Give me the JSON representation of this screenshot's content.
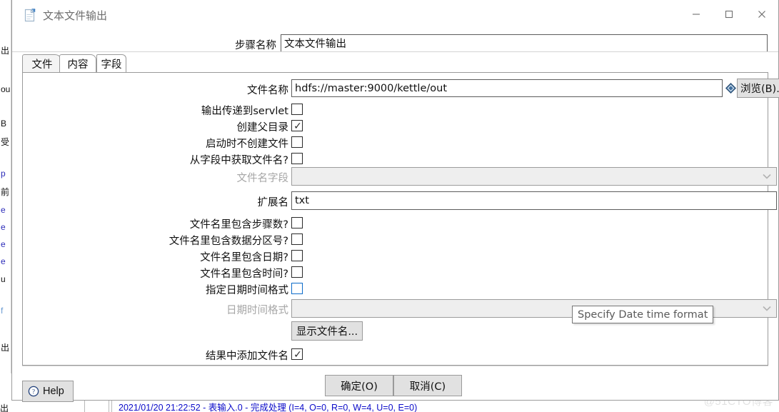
{
  "background": {
    "left_strip_lines": [
      "出",
      "ou",
      "B",
      "受",
      "p",
      "前",
      "e",
      "e",
      "e",
      "e",
      "u",
      "f",
      "出"
    ],
    "bottom_log": "2021/01/20 21:22:52 - 表输入.0 - 完成处理 (I=4, O=0, R=0, W=4, U=0, E=0)",
    "bottom_left_label": "出",
    "watermark": "@51CTO博客"
  },
  "window": {
    "title": "文本文件输出",
    "icon": "document-output-icon",
    "minimize": "—",
    "maximize": "□",
    "close": "✕"
  },
  "step": {
    "label": "步骤名称",
    "value": "文本文件输出"
  },
  "tabs": [
    {
      "label": "文件",
      "selected": true
    },
    {
      "label": "内容",
      "selected": false
    },
    {
      "label": "字段",
      "selected": false
    }
  ],
  "fields": {
    "filename": {
      "label": "文件名称",
      "value": "hdfs://master:9000/kettle/out",
      "browse": "浏览(B)..."
    },
    "pass_to_servlet": {
      "label": "输出传递到servlet",
      "checked": false
    },
    "create_parent_folder": {
      "label": "创建父目录",
      "checked": true
    },
    "do_not_create_at_start": {
      "label": "启动时不创建文件",
      "checked": false
    },
    "filename_from_field": {
      "label": "从字段中获取文件名?",
      "checked": false
    },
    "filename_field": {
      "label": "文件名字段",
      "value": "",
      "disabled": true
    },
    "extension": {
      "label": "扩展名",
      "value": "txt"
    },
    "include_stepnr": {
      "label": "文件名里包含步骤数?",
      "checked": false
    },
    "include_partnr": {
      "label": "文件名里包含数据分区号?",
      "checked": false
    },
    "include_date": {
      "label": "文件名里包含日期?",
      "checked": false
    },
    "include_time": {
      "label": "文件名里包含时间?",
      "checked": false
    },
    "specify_date_format": {
      "label": "指定日期时间格式",
      "checked": false,
      "focused": true
    },
    "date_time_format": {
      "label": "日期时间格式",
      "value": "",
      "disabled": true
    },
    "show_filenames_button": "显示文件名...",
    "add_to_result": {
      "label": "结果中添加文件名",
      "checked": true
    }
  },
  "tooltip": {
    "text": "Specify Date time format"
  },
  "footer": {
    "help": "Help",
    "ok": "确定(O)",
    "cancel": "取消(C)"
  }
}
